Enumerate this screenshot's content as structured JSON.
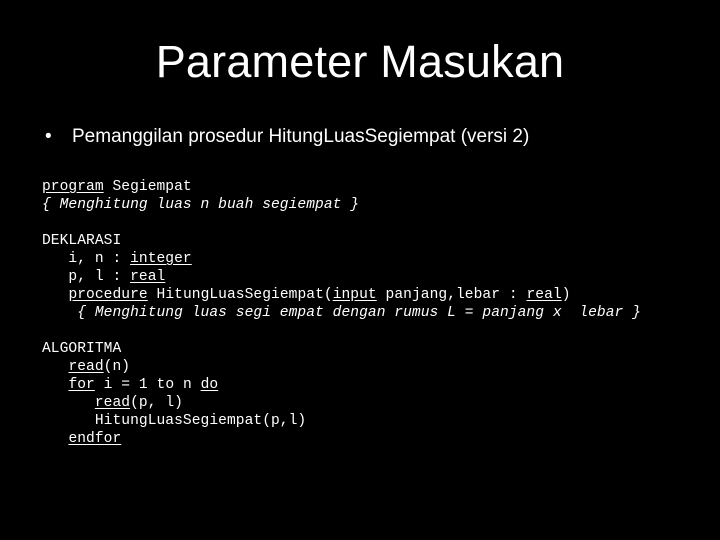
{
  "slide": {
    "background_color": "#000000",
    "text_color": "#ffffff",
    "title": "Parameter Masukan"
  },
  "bullets": [
    {
      "marker": "•",
      "text": "Pemanggilan prosedur HitungLuasSegiempat (versi 2)"
    }
  ],
  "code": {
    "lines": [
      {
        "id": "line-program",
        "segments": [
          {
            "text": "program",
            "style": "keyword"
          },
          {
            "text": " Segiempat",
            "style": "plain"
          }
        ]
      },
      {
        "id": "line-comment-1",
        "segments": [
          {
            "text": "{ Menghitung luas n buah segiempat }",
            "style": "comment"
          }
        ]
      },
      {
        "id": "line-blank-1",
        "segments": [
          {
            "text": "",
            "style": "plain"
          }
        ]
      },
      {
        "id": "line-deklarasi",
        "segments": [
          {
            "text": "DEKLARASI",
            "style": "plain"
          }
        ]
      },
      {
        "id": "line-decl-int",
        "segments": [
          {
            "text": "   i, n : ",
            "style": "plain"
          },
          {
            "text": "integer",
            "style": "keyword"
          }
        ]
      },
      {
        "id": "line-decl-real",
        "segments": [
          {
            "text": "   p, l : ",
            "style": "plain"
          },
          {
            "text": "real",
            "style": "keyword"
          }
        ]
      },
      {
        "id": "line-procedure",
        "segments": [
          {
            "text": "   ",
            "style": "plain"
          },
          {
            "text": "procedure",
            "style": "keyword"
          },
          {
            "text": " HitungLuasSegiempat(",
            "style": "plain"
          },
          {
            "text": "input",
            "style": "keyword"
          },
          {
            "text": " panjang,lebar : ",
            "style": "plain"
          },
          {
            "text": "real",
            "style": "keyword"
          },
          {
            "text": ")",
            "style": "plain"
          }
        ]
      },
      {
        "id": "line-comment-2",
        "segments": [
          {
            "text": "    { Menghitung luas segi empat dengan rumus L = panjang x  lebar }",
            "style": "comment"
          }
        ]
      },
      {
        "id": "line-blank-2",
        "segments": [
          {
            "text": "",
            "style": "plain"
          }
        ]
      },
      {
        "id": "line-algoritma",
        "segments": [
          {
            "text": "ALGORITMA",
            "style": "plain"
          }
        ]
      },
      {
        "id": "line-read-n",
        "segments": [
          {
            "text": "   ",
            "style": "plain"
          },
          {
            "text": "read",
            "style": "keyword"
          },
          {
            "text": "(n)",
            "style": "plain"
          }
        ]
      },
      {
        "id": "line-for",
        "segments": [
          {
            "text": "   ",
            "style": "plain"
          },
          {
            "text": "for",
            "style": "keyword"
          },
          {
            "text": " i = 1 to n ",
            "style": "plain"
          },
          {
            "text": "do",
            "style": "keyword"
          }
        ]
      },
      {
        "id": "line-read-pl",
        "segments": [
          {
            "text": "      ",
            "style": "plain"
          },
          {
            "text": "read",
            "style": "keyword"
          },
          {
            "text": "(p, l)",
            "style": "plain"
          }
        ]
      },
      {
        "id": "line-call",
        "segments": [
          {
            "text": "      HitungLuasSegiempat(p,l)",
            "style": "plain"
          }
        ]
      },
      {
        "id": "line-endfor",
        "segments": [
          {
            "text": "   ",
            "style": "plain"
          },
          {
            "text": "endfor",
            "style": "keyword"
          }
        ]
      }
    ]
  }
}
